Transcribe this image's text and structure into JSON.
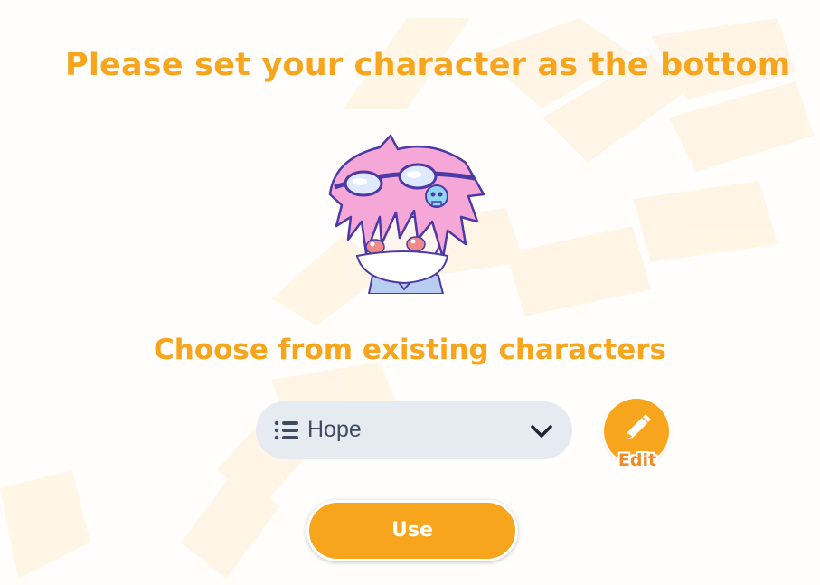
{
  "page": {
    "title": "Please set your character as the bottom",
    "subtitle": "Choose from existing characters"
  },
  "avatar": {
    "icon": "character-avatar-image",
    "hair_color": "#f5a8d8",
    "outline_color": "#4b3aa6"
  },
  "character_select": {
    "selected_value": "Hope",
    "icon": "list-icon",
    "dropdown_icon": "chevron-down-icon"
  },
  "edit_button": {
    "label": "Edit",
    "icon": "pencil-icon"
  },
  "use_button": {
    "label": "Use"
  },
  "colors": {
    "accent": "#f7a51c",
    "select_bg": "#e6ebf2",
    "select_text": "#3f4b60"
  }
}
